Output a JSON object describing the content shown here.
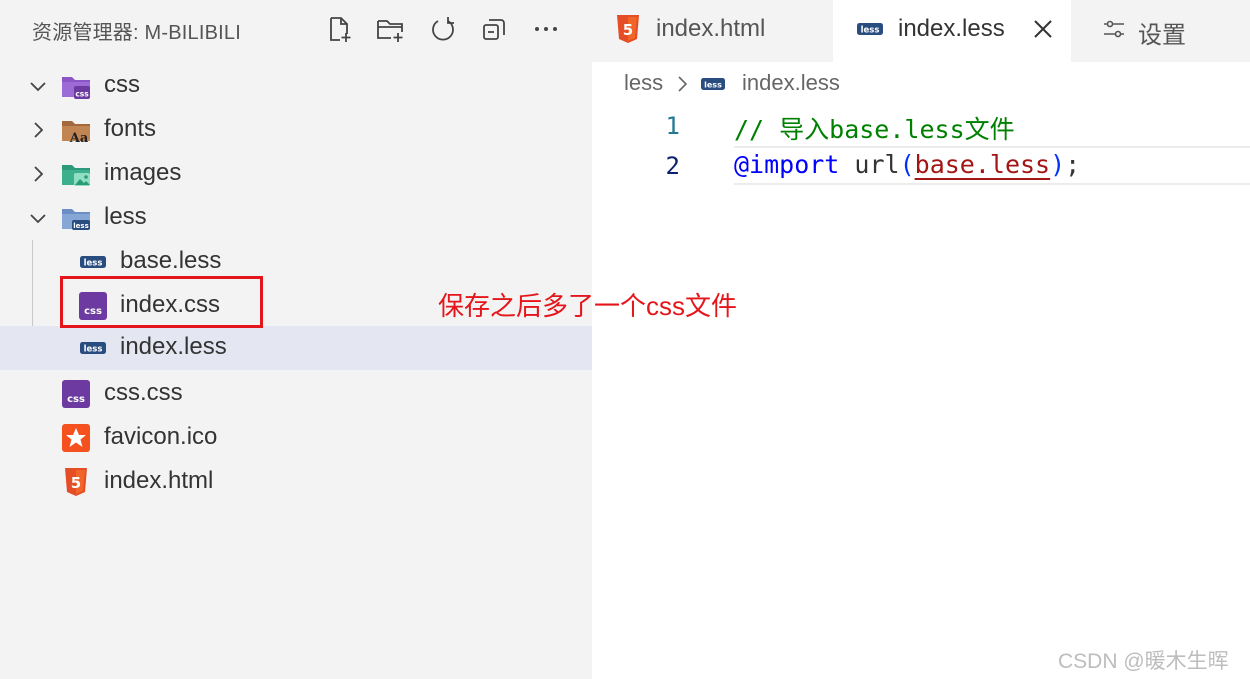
{
  "explorer": {
    "title": "资源管理器: M-BILIBILI",
    "actions": [
      {
        "name": "new-file-icon"
      },
      {
        "name": "new-folder-icon"
      },
      {
        "name": "refresh-icon"
      },
      {
        "name": "collapse-all-icon"
      },
      {
        "name": "more-icon"
      }
    ],
    "tree": [
      {
        "label": "css",
        "type": "folder",
        "expanded": true,
        "icon": "css-folder-icon"
      },
      {
        "label": "fonts",
        "type": "folder",
        "expanded": false,
        "icon": "fonts-folder-icon"
      },
      {
        "label": "images",
        "type": "folder",
        "expanded": false,
        "icon": "images-folder-icon"
      },
      {
        "label": "less",
        "type": "folder",
        "expanded": true,
        "icon": "less-folder-icon"
      },
      {
        "label": "base.less",
        "type": "file",
        "icon": "less-file-icon"
      },
      {
        "label": "index.css",
        "type": "file",
        "icon": "css-file-icon"
      },
      {
        "label": "index.less",
        "type": "file",
        "icon": "less-file-icon",
        "selected": true
      },
      {
        "label": "css.css",
        "type": "file",
        "icon": "css-file-icon"
      },
      {
        "label": "favicon.ico",
        "type": "file",
        "icon": "favicon-file-icon"
      },
      {
        "label": "index.html",
        "type": "file",
        "icon": "html-file-icon"
      }
    ]
  },
  "tabs": [
    {
      "label": "index.html",
      "icon": "html-file-icon",
      "active": false
    },
    {
      "label": "index.less",
      "icon": "less-file-icon",
      "active": true,
      "closable": true
    },
    {
      "label": "设置",
      "icon": "settings-icon",
      "active": false
    }
  ],
  "breadcrumb": {
    "folder": "less",
    "file": "index.less"
  },
  "editor": {
    "lines": [
      {
        "number": "1",
        "comment": "// 导入base.less文件"
      },
      {
        "number": "2",
        "at_rule": "@import",
        "func": "url",
        "paren_open": "(",
        "arg": "base.less",
        "paren_close": ")",
        "semi": ";"
      }
    ]
  },
  "annotation": "保存之后多了一个css文件",
  "watermark": "CSDN @暖木生晖",
  "colors": {
    "sidebar_bg": "#f3f3f3",
    "selected_row": "#e4e6f1",
    "annotation_red": "#e5161b",
    "css_purple": "#6c3aa0",
    "less_blue": "#2a4d80",
    "html_orange": "#e44d26",
    "comment_green": "#008000",
    "keyword_blue": "#0000ff",
    "string_red": "#a31515",
    "line_number_teal": "#237893"
  }
}
